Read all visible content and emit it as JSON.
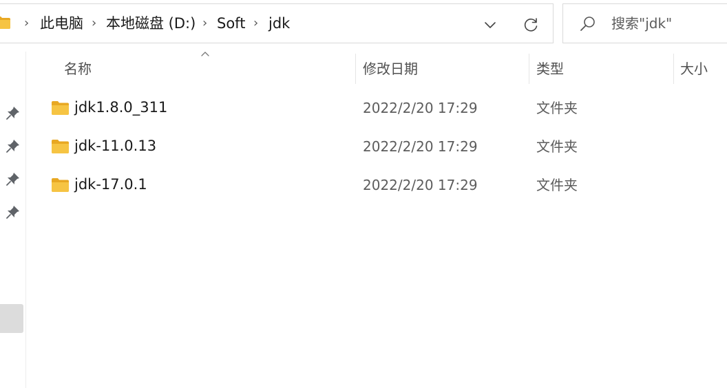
{
  "address_bar": {
    "breadcrumbs": [
      "此电脑",
      "本地磁盘 (D:)",
      "Soft",
      "jdk"
    ],
    "separator": "›"
  },
  "search": {
    "placeholder": "搜索\"jdk\""
  },
  "columns": {
    "name": "名称",
    "date_modified": "修改日期",
    "type": "类型",
    "size": "大小"
  },
  "files": [
    {
      "name": "jdk1.8.0_311",
      "date_modified": "2022/2/20 17:29",
      "type": "文件夹"
    },
    {
      "name": "jdk-11.0.13",
      "date_modified": "2022/2/20 17:29",
      "type": "文件夹"
    },
    {
      "name": "jdk-17.0.1",
      "date_modified": "2022/2/20 17:29",
      "type": "文件夹"
    }
  ],
  "icons": {
    "folder": "folder-icon",
    "pin": "pin-icon",
    "dropdown": "chevron-down-icon",
    "refresh": "refresh-icon",
    "search": "search-icon",
    "sort": "sort-up-icon"
  },
  "colors": {
    "folder_body": "#f6c443",
    "folder_tab": "#e8a823",
    "border": "#d9d9d9",
    "header_text": "#505050",
    "secondary_text": "#5c5c5c",
    "nav_selected": "#dcdcdc"
  }
}
